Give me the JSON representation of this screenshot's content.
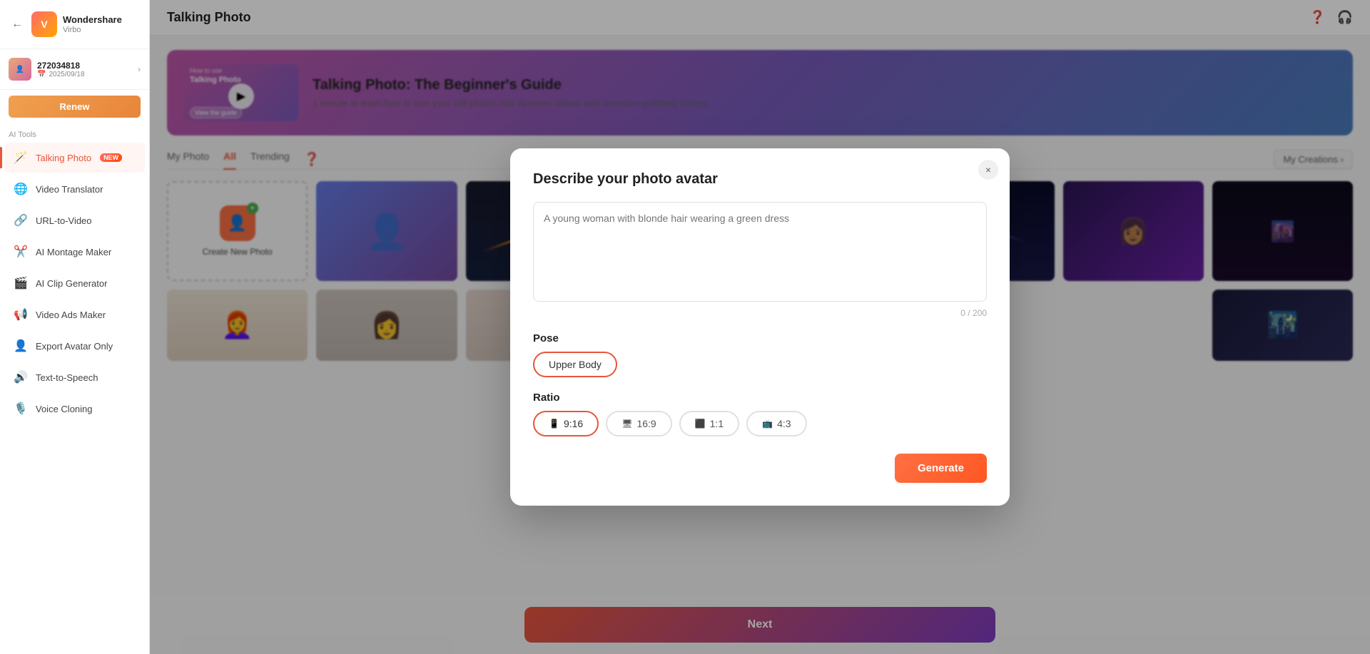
{
  "app": {
    "brand": "Wondershare",
    "logo_letter": "V",
    "product": "Virbo",
    "back_label": "←"
  },
  "user": {
    "id": "272034818",
    "date": "2025/09/18",
    "renew_label": "Renew"
  },
  "sidebar": {
    "ai_tools_label": "AI Tools",
    "items": [
      {
        "id": "talking-photo",
        "label": "Talking Photo",
        "icon": "🪄",
        "is_new": true,
        "is_active": true
      },
      {
        "id": "video-translator",
        "label": "Video Translator",
        "icon": "🌐",
        "is_new": false,
        "is_active": false
      },
      {
        "id": "url-to-video",
        "label": "URL-to-Video",
        "icon": "🔗",
        "is_new": false,
        "is_active": false
      },
      {
        "id": "ai-montage-maker",
        "label": "AI Montage Maker",
        "icon": "✂️",
        "is_new": false,
        "is_active": false
      },
      {
        "id": "ai-clip-generator",
        "label": "AI Clip Generator",
        "icon": "🎬",
        "is_new": false,
        "is_active": false
      },
      {
        "id": "video-ads-maker",
        "label": "Video Ads Maker",
        "icon": "📢",
        "is_new": false,
        "is_active": false
      },
      {
        "id": "export-avatar-only",
        "label": "Export Avatar Only",
        "icon": "👤",
        "is_new": false,
        "is_active": false
      },
      {
        "id": "text-to-speech",
        "label": "Text-to-Speech",
        "icon": "🔊",
        "is_new": false,
        "is_active": false
      },
      {
        "id": "voice-cloning",
        "label": "Voice Cloning",
        "icon": "🎙️",
        "is_new": false,
        "is_active": false
      }
    ]
  },
  "header": {
    "title": "Talking Photo",
    "help_icon": "?",
    "headphone_icon": "🎧"
  },
  "banner": {
    "how_to_use": "How to use",
    "title_label": "Talking Photo",
    "view_guide": "View the guide",
    "guide_title": "Talking Photo: The Beginner's Guide",
    "guide_desc": "1 minute to learn how to turn your still photos into dynamic videos with attention-grabbing voices."
  },
  "tabs": [
    {
      "id": "my-photo",
      "label": "My Photo",
      "active": false
    },
    {
      "id": "all",
      "label": "All",
      "active": true
    },
    {
      "id": "trending",
      "label": "Trending",
      "active": false
    }
  ],
  "my_creations_btn": "My Creations ›",
  "create_new": {
    "label": "Create New Photo"
  },
  "next_btn": "Next",
  "modal": {
    "title": "Describe your photo avatar",
    "textarea_placeholder": "A young woman with blonde hair wearing a green dress",
    "char_count": "0 / 200",
    "pose_label": "Pose",
    "pose_selected": "Upper Body",
    "ratio_label": "Ratio",
    "ratios": [
      {
        "id": "9-16",
        "label": "9:16",
        "icon": "📱",
        "active": true
      },
      {
        "id": "16-9",
        "label": "16:9",
        "icon": "🖥",
        "active": false
      },
      {
        "id": "1-1",
        "label": "1:1",
        "icon": "⬛",
        "active": false
      },
      {
        "id": "4-3",
        "label": "4:3",
        "icon": "📺",
        "active": false
      }
    ],
    "generate_btn": "Generate",
    "close_btn": "×"
  }
}
